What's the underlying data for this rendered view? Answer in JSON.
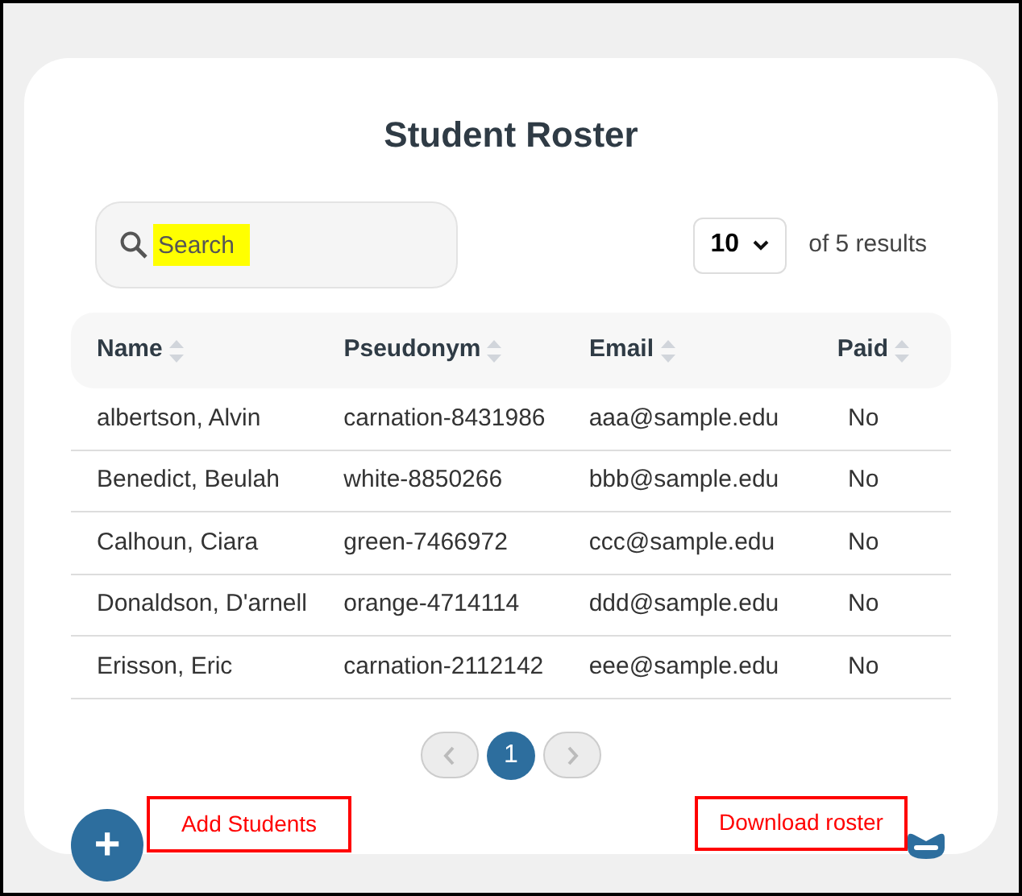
{
  "title": "Student Roster",
  "search": {
    "placeholder": "Search"
  },
  "page_size": {
    "value": "10",
    "results": "of 5 results"
  },
  "table": {
    "columns": [
      "Name",
      "Pseudonym",
      "Email",
      "Paid"
    ],
    "rows": [
      [
        "albertson, Alvin",
        "carnation-8431986",
        "aaa@sample.edu",
        "No"
      ],
      [
        "Benedict, Beulah",
        "white-8850266",
        "bbb@sample.edu",
        "No"
      ],
      [
        "Calhoun, Ciara",
        "green-7466972",
        "ccc@sample.edu",
        "No"
      ],
      [
        "Donaldson, D'arnell",
        "orange-4714114",
        "ddd@sample.edu",
        "No"
      ],
      [
        "Erisson, Eric",
        "carnation-2112142",
        "eee@sample.edu",
        "No"
      ]
    ]
  },
  "pagination": {
    "pages": [
      {
        "label": "1",
        "selected": true
      }
    ]
  },
  "add_button": {
    "icon": "+"
  },
  "add_label": "Add Students",
  "download_label": "Download roster"
}
